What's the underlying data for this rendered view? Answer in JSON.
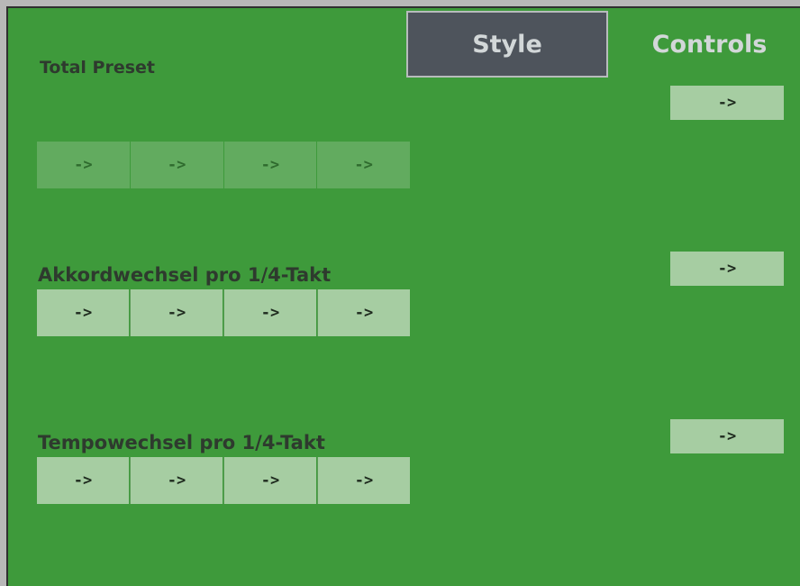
{
  "tabs": {
    "style_label": "Style",
    "controls_label": "Controls"
  },
  "sections": {
    "total_preset": {
      "label": "Total Preset",
      "buttons": [
        "->",
        "->",
        "->",
        "->"
      ]
    },
    "akkordwechsel": {
      "label": "Akkordwechsel pro 1/4-Takt",
      "buttons": [
        "->",
        "->",
        "->",
        "->"
      ]
    },
    "tempowechsel": {
      "label": "Tempowechsel pro 1/4-Takt",
      "buttons": [
        "->",
        "->",
        "->",
        "->"
      ]
    }
  },
  "side_buttons": [
    "->",
    "->",
    "->"
  ],
  "colors": {
    "panel_bg": "#3e9a3b",
    "button_active": "#a6cda2",
    "button_dim": "#62ab5f",
    "tab_selected": "#4e545c"
  }
}
